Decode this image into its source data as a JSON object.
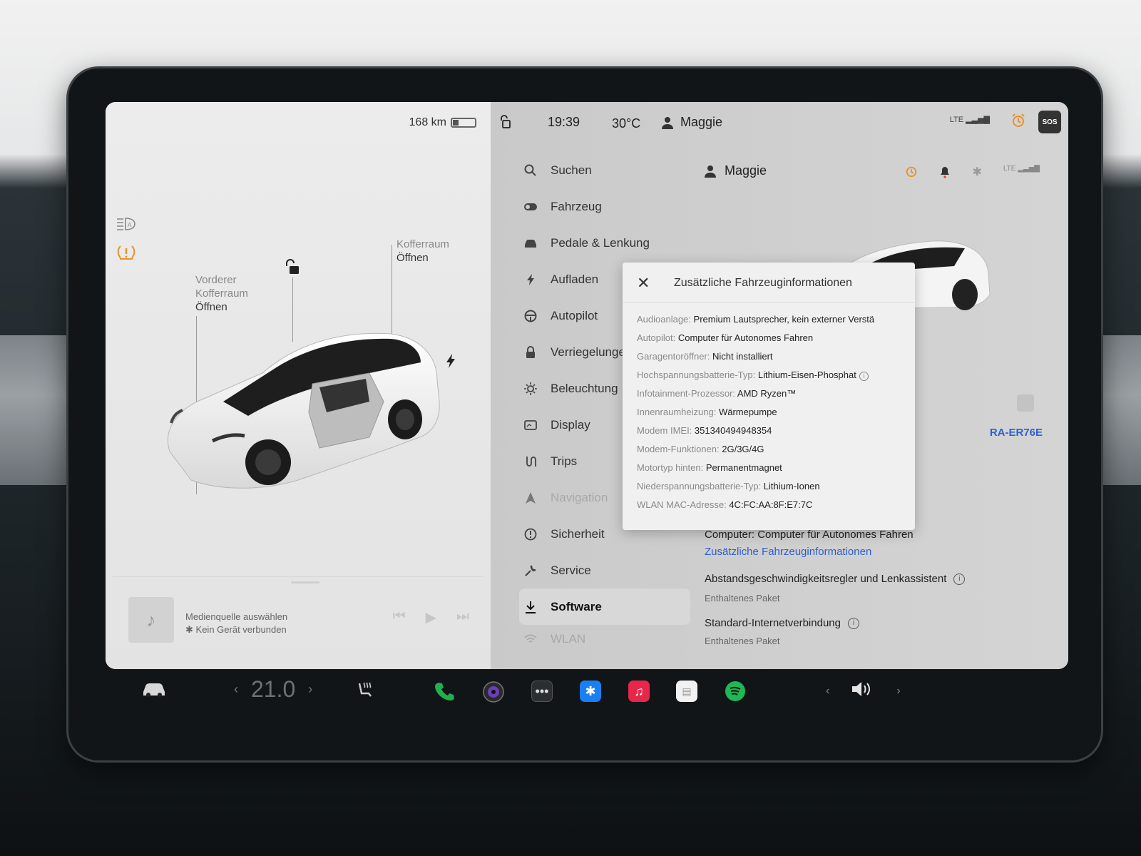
{
  "left": {
    "range_text": "168 km",
    "battery_level_pct": 25,
    "frunk_label_line1": "Vorderer",
    "frunk_label_line2": "Kofferraum",
    "frunk_action": "Öffnen",
    "trunk_label": "Kofferraum",
    "trunk_action": "Öffnen",
    "media_source": "Medienquelle auswählen",
    "media_device": "Kein Gerät verbunden"
  },
  "status": {
    "time": "19:39",
    "temperature": "30°C",
    "user": "Maggie",
    "network": "LTE",
    "sos": "SOS"
  },
  "menu": {
    "items": [
      {
        "label": "Suchen",
        "icon": "search-icon"
      },
      {
        "label": "Fahrzeug",
        "icon": "toggle-icon"
      },
      {
        "label": "Pedale & Lenkung",
        "icon": "car-icon"
      },
      {
        "label": "Aufladen",
        "icon": "bolt-icon"
      },
      {
        "label": "Autopilot",
        "icon": "steering-wheel-icon"
      },
      {
        "label": "Verriegelungen",
        "icon": "lock-icon"
      },
      {
        "label": "Beleuchtung",
        "icon": "sun-icon"
      },
      {
        "label": "Display",
        "icon": "display-icon"
      },
      {
        "label": "Trips",
        "icon": "route-icon"
      },
      {
        "label": "Navigation",
        "icon": "navigation-arrow-icon"
      },
      {
        "label": "Sicherheit",
        "icon": "alert-circle-icon"
      },
      {
        "label": "Service",
        "icon": "wrench-icon"
      },
      {
        "label": "Software",
        "icon": "download-icon"
      },
      {
        "label": "WLAN",
        "icon": "wifi-icon"
      }
    ],
    "active_index": 12
  },
  "detail": {
    "user": "Maggie",
    "vin_code": "RA-ER76E",
    "computer_label": "Computer: Computer für Autonomes Fahren",
    "more_info_link": "Zusätzliche Fahrzeuginformationen",
    "package1_title": "Abstandsgeschwindigkeitsregler und Lenkassistent",
    "package1_sub": "Enthaltenes Paket",
    "package2_title": "Standard-Internetverbindung",
    "package2_sub": "Enthaltenes Paket"
  },
  "modal": {
    "title": "Zusätzliche Fahrzeuginformationen",
    "rows": [
      {
        "key": "Audioanlage:",
        "value": "Premium Lautsprecher, kein externer Verstä"
      },
      {
        "key": "Autopilot:",
        "value": "Computer für Autonomes Fahren"
      },
      {
        "key": "Garagentoröffner:",
        "value": "Nicht installiert"
      },
      {
        "key": "Hochspannungsbatterie-Typ:",
        "value": "Lithium-Eisen-Phosphat"
      },
      {
        "key": "Infotainment-Prozessor:",
        "value": "AMD Ryzen™"
      },
      {
        "key": "Innenraumheizung:",
        "value": "Wärmepumpe"
      },
      {
        "key": "Modem IMEI:",
        "value": "351340494948354"
      },
      {
        "key": "Modem-Funktionen:",
        "value": "2G/3G/4G"
      },
      {
        "key": "Motortyp hinten:",
        "value": "Permanentmagnet"
      },
      {
        "key": "Niederspannungsbatterie-Typ:",
        "value": "Lithium-Ionen"
      },
      {
        "key": "WLAN MAC-Adresse:",
        "value": "4C:FC:AA:8F:E7:7C"
      }
    ]
  },
  "dock": {
    "cabin_temp": "21.0",
    "colors": {
      "phone": "#22b04a",
      "bluetooth": "#1a7ff0",
      "music": "#e8264a",
      "spotify": "#1db954"
    }
  }
}
